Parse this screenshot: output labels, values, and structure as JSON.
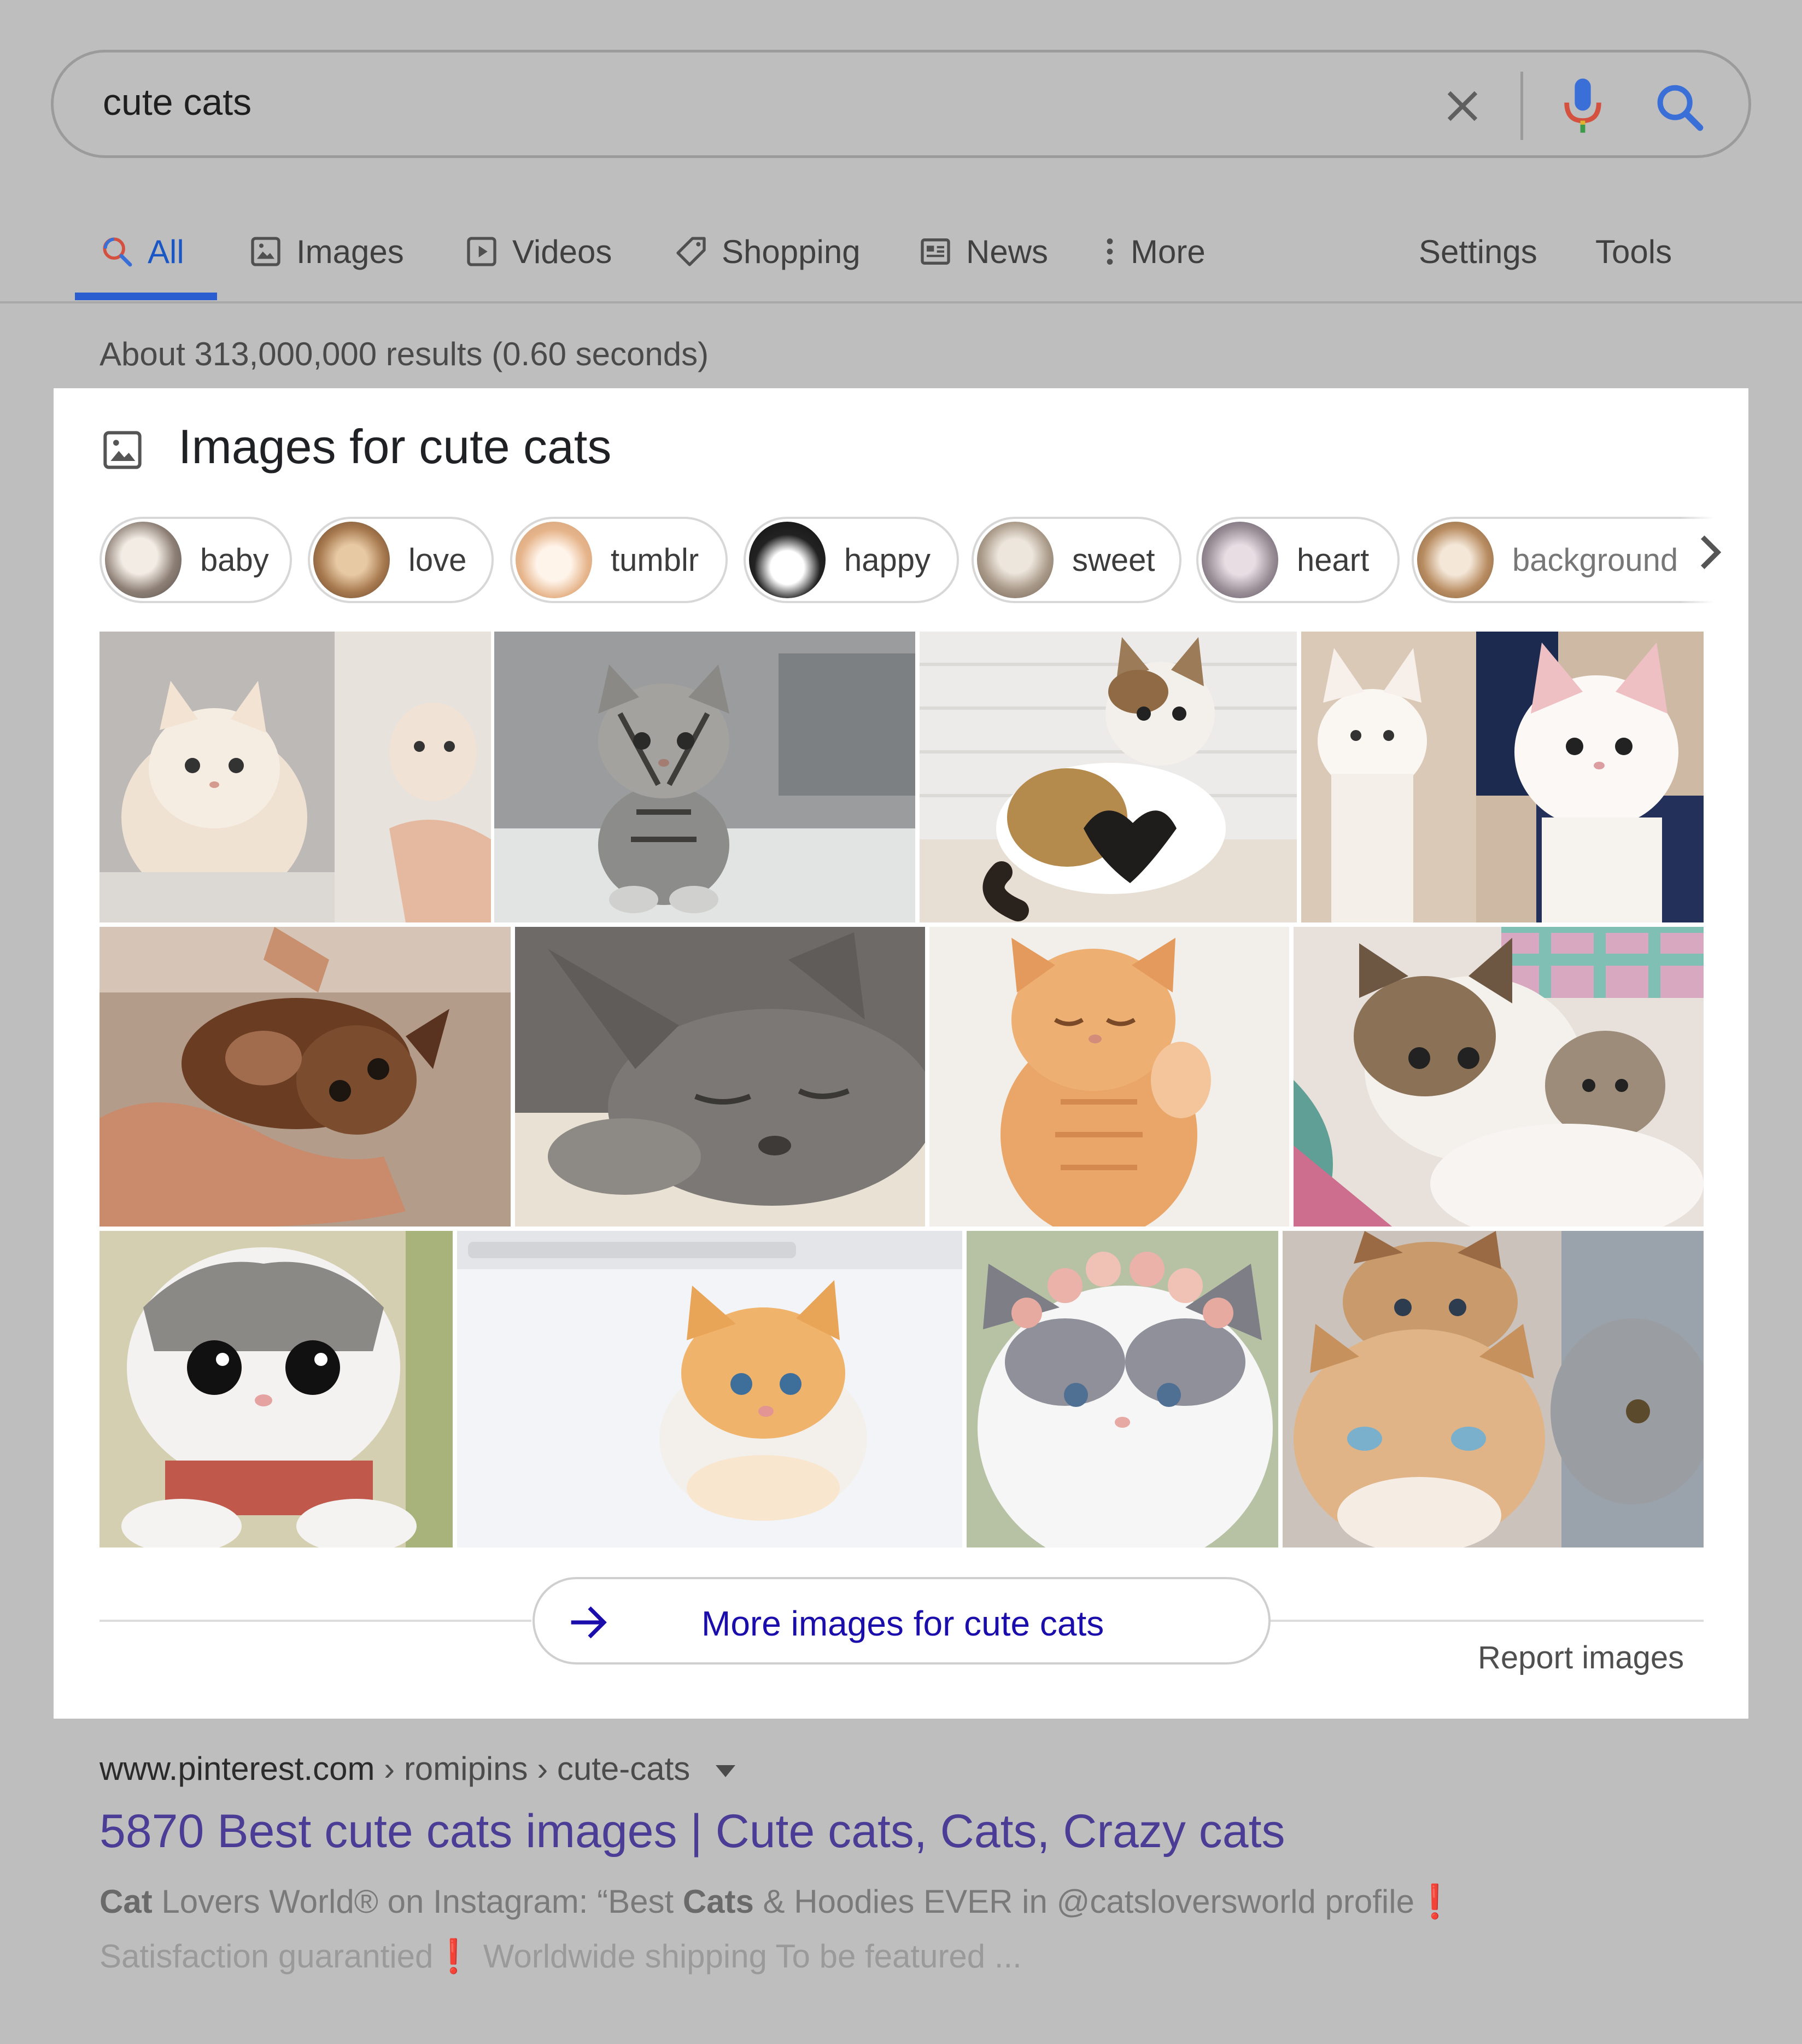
{
  "search": {
    "query": "cute cats",
    "clear_icon": "close-icon",
    "mic_icon": "microphone-icon",
    "search_icon": "search-icon"
  },
  "tabs": [
    {
      "label": "All",
      "icon": "search-icon",
      "active": true
    },
    {
      "label": "Images",
      "icon": "image-icon"
    },
    {
      "label": "Videos",
      "icon": "play-icon"
    },
    {
      "label": "Shopping",
      "icon": "tag-icon"
    },
    {
      "label": "News",
      "icon": "newspaper-icon"
    },
    {
      "label": "More",
      "icon": "more-vert-icon"
    }
  ],
  "tools": {
    "settings": "Settings",
    "tools": "Tools"
  },
  "results_stats": "About 313,000,000 results (0.60 seconds)",
  "image_panel": {
    "title": "Images for cute cats",
    "chips": [
      {
        "label": "baby"
      },
      {
        "label": "love"
      },
      {
        "label": "tumblr"
      },
      {
        "label": "happy"
      },
      {
        "label": "sweet"
      },
      {
        "label": "heart"
      },
      {
        "label": "background"
      }
    ],
    "more_button": "More images for cute cats",
    "report": "Report images"
  },
  "result": {
    "domain": "www.pinterest.com",
    "path": " › romipins › cute-cats",
    "title": "5870 Best cute cats images | Cute cats, Cats, Crazy cats",
    "snippet_line1_a": "Cat",
    "snippet_line1_b": " Lovers World® on Instagram: “Best ",
    "snippet_line1_c": "Cats",
    "snippet_line1_d": " & Hoodies EVER in @catsloversworld profile",
    "snippet_line2_a": "Satisfaction guarantied",
    "snippet_line2_b": "  Worldwide shipping To be featured  ..."
  },
  "colors": {
    "page_background": "#bebebe",
    "accent": "#2a5ed0",
    "link": "#1a0dab",
    "visited_title": "#4b3d96"
  }
}
